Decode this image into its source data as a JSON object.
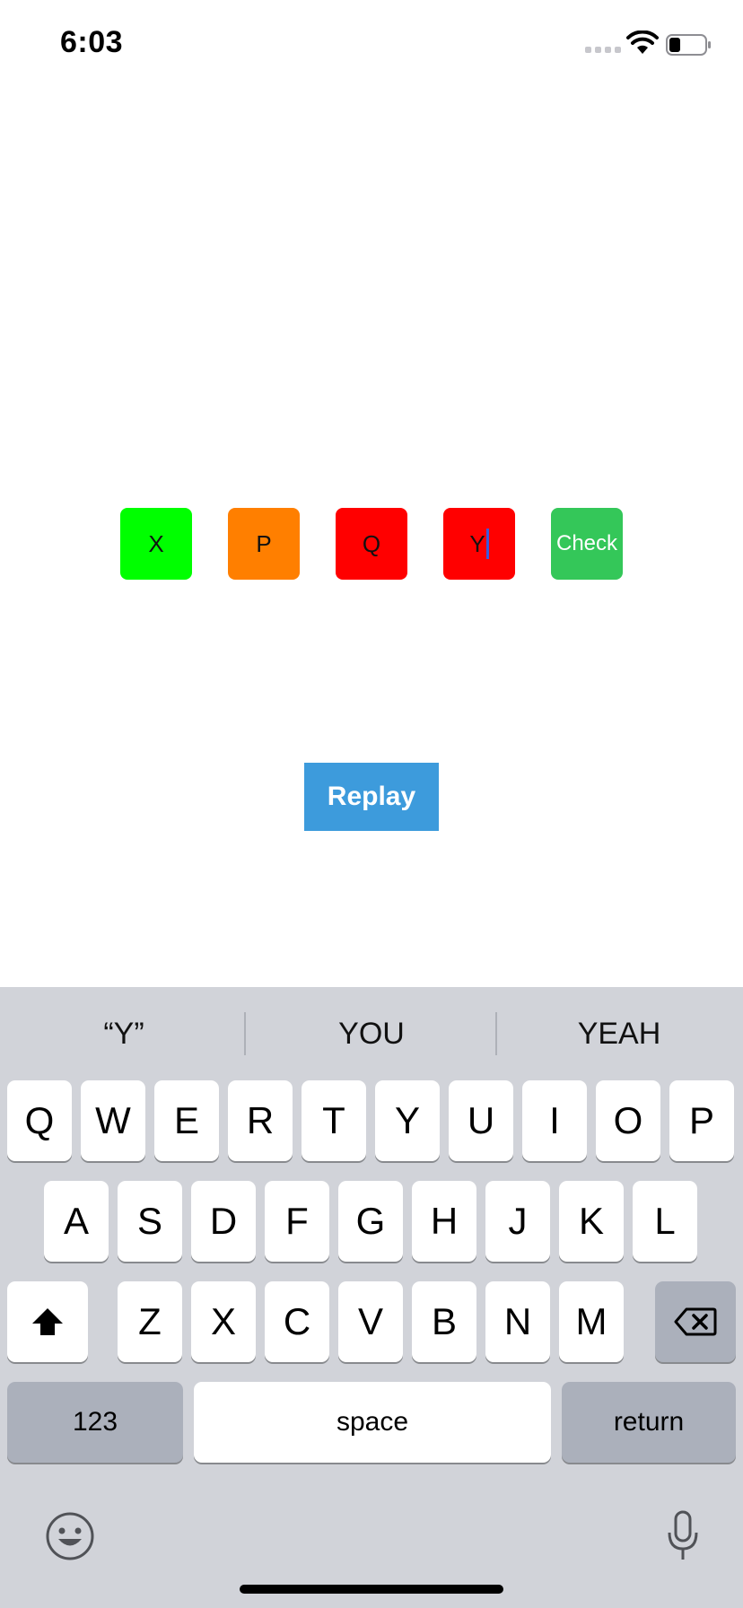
{
  "status_bar": {
    "time": "6:03"
  },
  "game": {
    "tiles": [
      {
        "letter": "X",
        "color": "#00ff00"
      },
      {
        "letter": "P",
        "color": "#ff7f00"
      },
      {
        "letter": "Q",
        "color": "#ff0000"
      },
      {
        "letter": "Y",
        "color": "#ff0000"
      }
    ],
    "check_label": "Check",
    "check_color": "#34c759",
    "replay_label": "Replay",
    "replay_color": "#3d9bdc"
  },
  "keyboard": {
    "suggestions": [
      "“Y”",
      "YOU",
      "YEAH"
    ],
    "row1": [
      "Q",
      "W",
      "E",
      "R",
      "T",
      "Y",
      "U",
      "I",
      "O",
      "P"
    ],
    "row2": [
      "A",
      "S",
      "D",
      "F",
      "G",
      "H",
      "J",
      "K",
      "L"
    ],
    "row3": [
      "Z",
      "X",
      "C",
      "V",
      "B",
      "N",
      "M"
    ],
    "numbers_label": "123",
    "space_label": "space",
    "return_label": "return",
    "icons": [
      "shift-icon",
      "backspace-icon",
      "emoji-icon",
      "microphone-icon"
    ]
  }
}
